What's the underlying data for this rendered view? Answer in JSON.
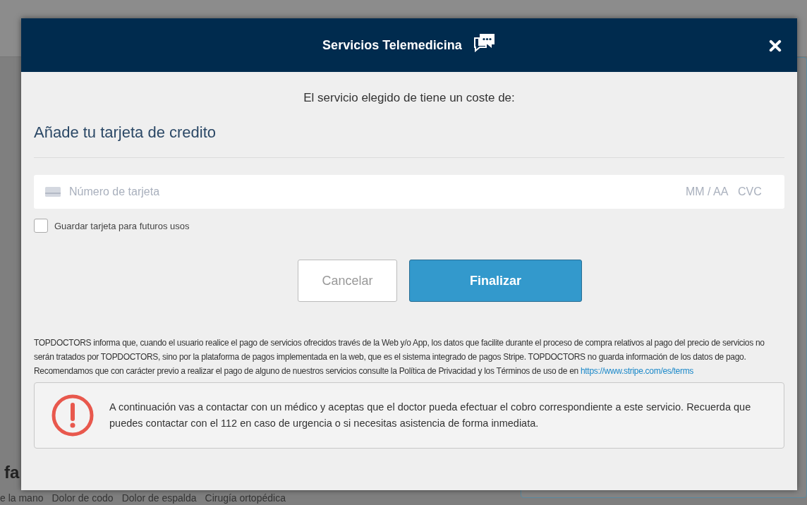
{
  "background": {
    "heading": "fa",
    "tags": [
      "e la mano",
      "Dolor de codo",
      "Dolor de espalda",
      "Cirugía ortopédica"
    ]
  },
  "modal": {
    "title": "Servicios Telemedicina",
    "cost_text": "El servicio elegido de tiene un coste de:",
    "section_title": "Añade tu tarjeta de credito",
    "card_field": {
      "placeholder": "Número de tarjeta",
      "expiry_placeholder": "MM / AA",
      "cvc_placeholder": "CVC"
    },
    "save_card": {
      "label": "Guardar tarjeta para futuros usos",
      "checked": false
    },
    "buttons": [
      {
        "label": "Cancelar",
        "kind": "secondary"
      },
      {
        "label": "Finalizar",
        "kind": "primary"
      }
    ],
    "legal_text": "TOPDOCTORS informa que, cuando el usuario realice el pago de servicios ofrecidos través de la Web y/o App, los datos que facilite durante el proceso de compra relativos al pago del precio de servicios no serán tratados por TOPDOCTORS, sino por la plataforma de pagos implementada en la web, que es el sistema integrado de pagos Stripe. TOPDOCTORS no guarda información de los datos de pago. Recomendamos que con carácter previo a realizar el pago de alguno de nuestros servicios consulte la Política de Privacidad y los Términos de uso de en",
    "legal_link": "https://www.stripe.com/es/terms",
    "alert": {
      "text": "A continuación vas a contactar con un médico y aceptas que el doctor pueda efectuar el cobro correspondiente a este servicio. Recuerda que puedes contactar con el 112 en caso de urgencia o si necesitas asistencia de forma inmediata."
    }
  }
}
